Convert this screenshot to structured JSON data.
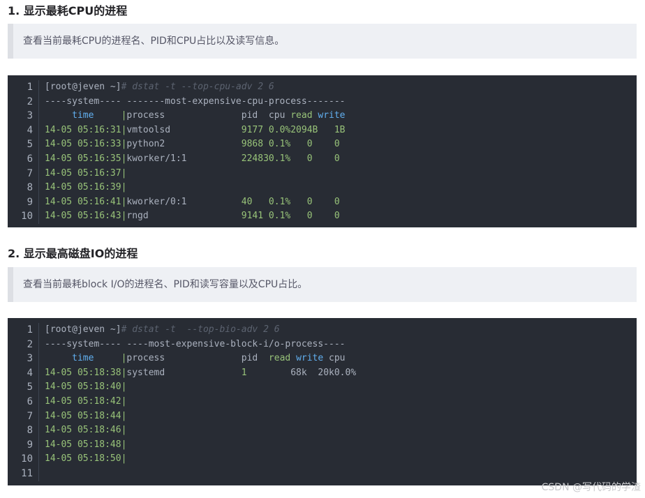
{
  "section1": {
    "heading": "1. 显示最耗CPU的进程",
    "description": "查看当前最耗CPU的进程名、PID和CPU占比以及读写信息。",
    "code": {
      "prompt": "[root@jeven ~]",
      "command": "# dstat -t --top-cpu-adv 2 6",
      "header_line": "----system---- -------most-expensive-cpu-process-------",
      "col_time": "     time     ",
      "col_process": "process              ",
      "col_pid": "pid  ",
      "col_cpu": "cpu ",
      "col_read": "read",
      "col_write": "write",
      "rows": [
        {
          "time": "14-05 05:16:31",
          "process": "vmtoolsd             ",
          "pid": "9177 ",
          "cpu": "0.0%",
          "read": "2094B",
          "write": "   1B"
        },
        {
          "time": "14-05 05:16:33",
          "process": "python2              ",
          "pid": "9868 ",
          "cpu": "0.1%",
          "read": "   0 ",
          "write": "   0"
        },
        {
          "time": "14-05 05:16:35",
          "process": "kworker/1:1          ",
          "pid": "22483",
          "cpu": "0.1%",
          "read": "   0 ",
          "write": "   0"
        },
        {
          "time": "14-05 05:16:37",
          "process": "",
          "pid": "",
          "cpu": "",
          "read": "",
          "write": ""
        },
        {
          "time": "14-05 05:16:39",
          "process": "",
          "pid": "",
          "cpu": "",
          "read": "",
          "write": ""
        },
        {
          "time": "14-05 05:16:41",
          "process": "kworker/0:1          ",
          "pid": "40   ",
          "cpu": "0.1%",
          "read": "   0 ",
          "write": "   0"
        },
        {
          "time": "14-05 05:16:43",
          "process": "rngd                 ",
          "pid": "9141 ",
          "cpu": "0.1%",
          "read": "   0 ",
          "write": "   0"
        }
      ]
    }
  },
  "section2": {
    "heading": "2. 显示最高磁盘IO的进程",
    "description": "查看当前最耗block I/O的进程名、PID和读写容量以及CPU占比。",
    "code": {
      "prompt": "[root@jeven ~]",
      "command": "# dstat -t  --top-bio-adv 2 6",
      "header_line": "----system---- ----most-expensive-block-i/o-process----",
      "col_time": "     time     ",
      "col_process": "process              ",
      "col_pid": "pid  ",
      "col_read": "read",
      "col_write": "write",
      "col_cpu": "cpu",
      "rows": [
        {
          "time": "14-05 05:18:38",
          "process": "systemd              ",
          "pid": "1    ",
          "read": "    68k",
          "write": "  20k",
          "cpu": "0.0%"
        },
        {
          "time": "14-05 05:18:40",
          "process": "",
          "pid": "",
          "read": "",
          "write": "",
          "cpu": ""
        },
        {
          "time": "14-05 05:18:42",
          "process": "",
          "pid": "",
          "read": "",
          "write": "",
          "cpu": ""
        },
        {
          "time": "14-05 05:18:44",
          "process": "",
          "pid": "",
          "read": "",
          "write": "",
          "cpu": ""
        },
        {
          "time": "14-05 05:18:46",
          "process": "",
          "pid": "",
          "read": "",
          "write": "",
          "cpu": ""
        },
        {
          "time": "14-05 05:18:48",
          "process": "",
          "pid": "",
          "read": "",
          "write": "",
          "cpu": ""
        },
        {
          "time": "14-05 05:18:50",
          "process": "",
          "pid": "",
          "read": "",
          "write": "",
          "cpu": ""
        }
      ]
    }
  },
  "line_numbers_1": [
    "1",
    "2",
    "3",
    "4",
    "5",
    "6",
    "7",
    "8",
    "9",
    "10"
  ],
  "line_numbers_2": [
    "1",
    "2",
    "3",
    "4",
    "5",
    "6",
    "7",
    "8",
    "9",
    "10",
    "11"
  ],
  "watermark": "CSDN @写代码的学渣"
}
